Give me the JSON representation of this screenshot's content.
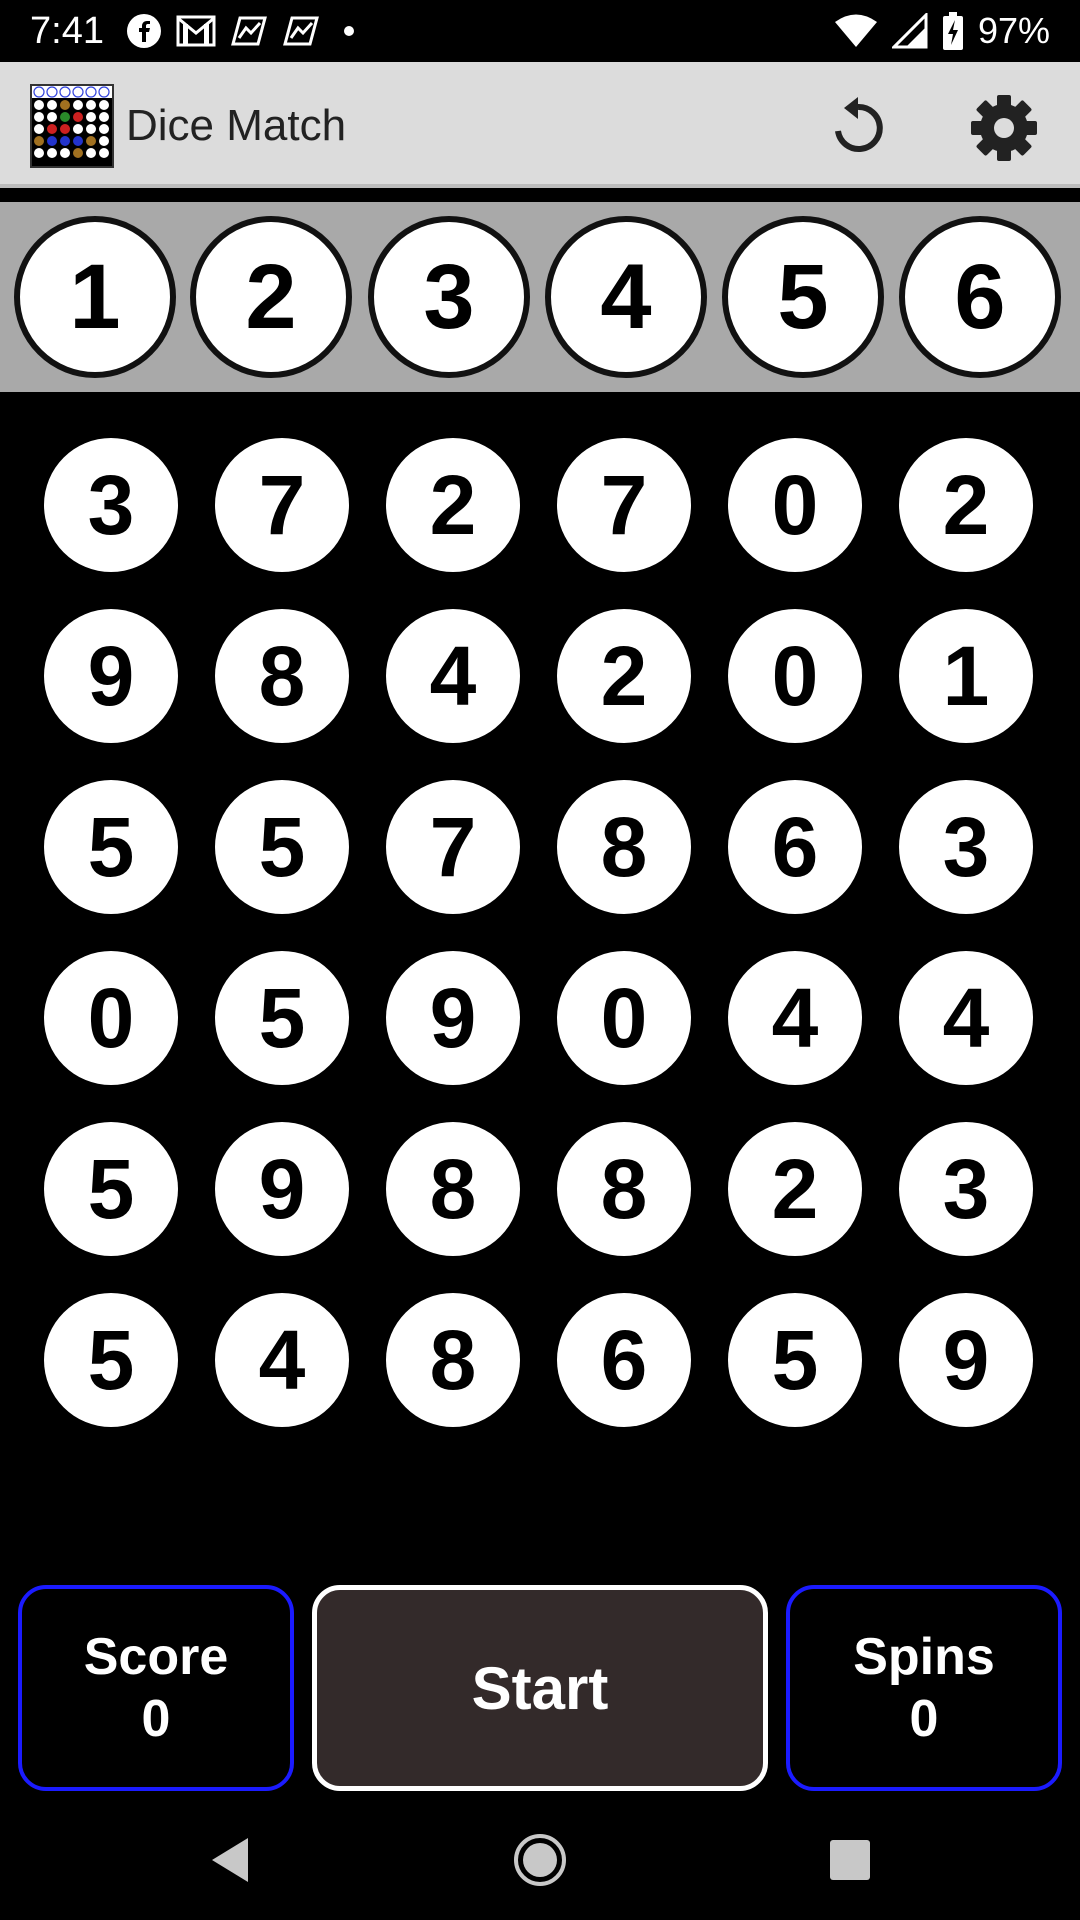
{
  "status_bar": {
    "time": "7:41",
    "battery": "97%",
    "left_icons": [
      "facebook-icon",
      "gmail-icon",
      "trend-app-icon",
      "trend-app-icon",
      "dot-icon"
    ],
    "right_icons": [
      "wifi-icon",
      "cell-signal-icon",
      "battery-charging-icon"
    ]
  },
  "app_bar": {
    "title": "Dice Match",
    "actions": [
      "reset-icon",
      "settings-icon"
    ],
    "background": "#dcdcdc"
  },
  "targets": [
    "1",
    "2",
    "3",
    "4",
    "5",
    "6"
  ],
  "board": [
    [
      "3",
      "7",
      "2",
      "7",
      "0",
      "2"
    ],
    [
      "9",
      "8",
      "4",
      "2",
      "0",
      "1"
    ],
    [
      "5",
      "5",
      "7",
      "8",
      "6",
      "3"
    ],
    [
      "0",
      "5",
      "9",
      "0",
      "4",
      "4"
    ],
    [
      "5",
      "9",
      "8",
      "8",
      "2",
      "3"
    ],
    [
      "5",
      "4",
      "8",
      "6",
      "5",
      "9"
    ]
  ],
  "controls": {
    "score_label": "Score",
    "score_value": "0",
    "start_label": "Start",
    "spins_label": "Spins",
    "spins_value": "0",
    "panel_border_color": "#1b1bff",
    "start_background": "#332a2a"
  },
  "nav_bar": {
    "buttons": [
      "back-icon",
      "home-icon",
      "recents-icon"
    ]
  }
}
